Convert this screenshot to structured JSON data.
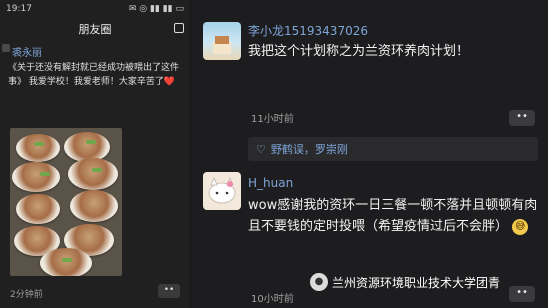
{
  "left": {
    "status_time": "19:17",
    "status_icons": "✉ ◎ ▮▮ ▮▮ ▭",
    "title": "朋友圈",
    "post": {
      "name": "裘永丽",
      "text": "《关于还没有解封就已经成功被喂出了这件事》 我爱学校！我爱老师！大家辛苦了❤️",
      "time": "2分钟前"
    },
    "more": "••"
  },
  "right": {
    "comment1": {
      "name": "李小龙15193437026",
      "text": "我把这个计划称之为兰资环养肉计划！",
      "time": "11小时前"
    },
    "likes": {
      "heart": "♡",
      "names": "野鹤误，罗崇刚"
    },
    "comment2": {
      "name": "H_huan",
      "text": "wow感谢我的资环一日三餐一顿不落并且顿顿有肉且不要钱的定时投喂（希望疫情过后不会胖）",
      "emoji": "😅",
      "time": "10小时前"
    },
    "more": "••"
  },
  "watermark": {
    "icon": "●",
    "text": "兰州资源环境职业技术大学团青"
  }
}
